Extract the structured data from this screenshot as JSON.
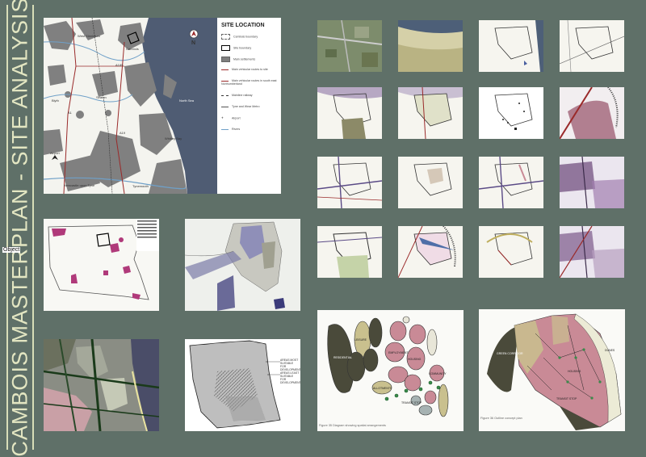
{
  "title": "CAMBOIS MASTERPLAN - SITE ANALYSIS",
  "object_tag": "Object",
  "location_map": {
    "north_label": "N",
    "labels": {
      "west_sleekburn": "West Sleekburn",
      "cambois": "Cambois",
      "north_sea": "North Sea",
      "a189": "A189",
      "blyth": "Blyth",
      "a1": "A1",
      "a19": "A19",
      "seaton": "Seaton",
      "whitley_bay": "Whitley Bay",
      "newcastle": "Newcastle upon Tyne",
      "airport": "Airport",
      "tynemouth": "Tynemouth"
    },
    "legend": {
      "title": "SITE LOCATION",
      "items": [
        "Cambois boundary",
        "Site boundary",
        "Main settlements",
        "Main vehicular routes to site",
        "Main vehicular routes in south east Northumberland",
        "Mainline railway",
        "Tyne and Wear Metro",
        "Airport",
        "Rivers"
      ]
    }
  },
  "hatch_plan": {
    "label_1": "AREAS MOST SUITABLE FOR DEVELOPMENT",
    "label_2": "AREAS LEAST SUITABLE FOR DEVELOPMENT"
  },
  "bubble_diagram": {
    "caption": "Figure 35 Diagram showing spatial arrangements",
    "labels": [
      "RESIDENTIAL",
      "LEISURE",
      "EMPLOYMENT",
      "HOUSING",
      "ALLOTMENTS",
      "TRANSIT STOP",
      "COMMUNITY"
    ]
  },
  "outline_plan": {
    "caption": "Figure 36 Outline concept plan",
    "labels": [
      "GREEN CORRIDOR",
      "HOUSING",
      "TRANSIT STOP",
      "DUNES"
    ]
  },
  "colors": {
    "background": "#5f7068",
    "title": "#e3e6c2",
    "pink": "#c98a96",
    "dark_olive": "#4a4a3a",
    "khaki": "#c9c08e",
    "sea": "#4f5c73",
    "purple": "#7b5a87"
  }
}
